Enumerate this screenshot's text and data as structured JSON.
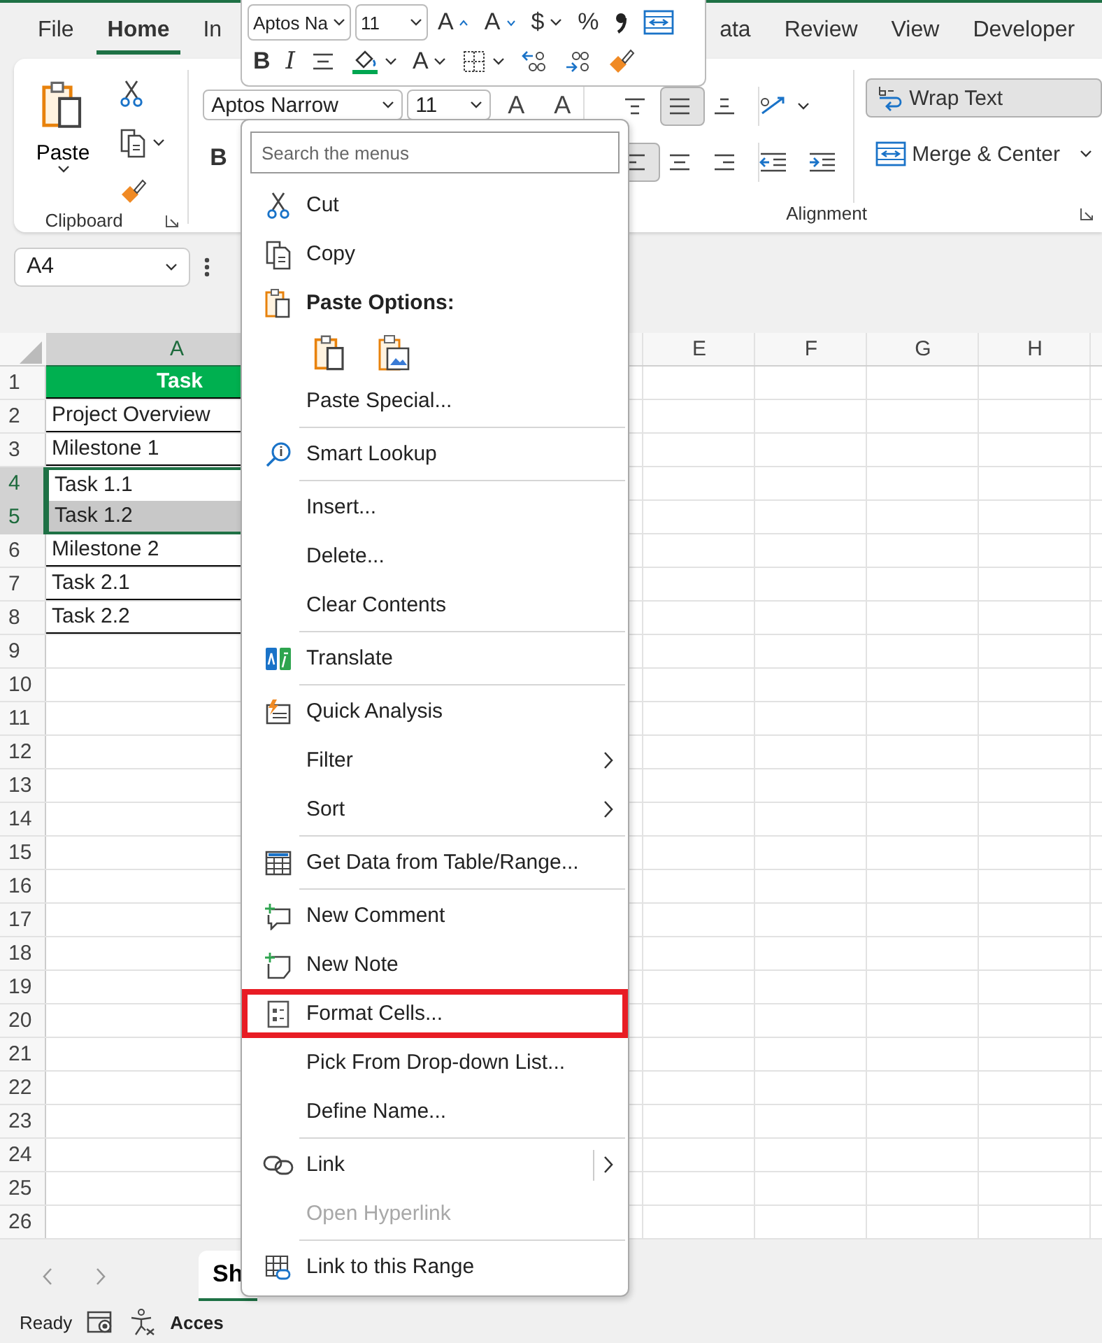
{
  "tabs": [
    {
      "label": "File",
      "selected": false
    },
    {
      "label": "Home",
      "selected": true
    },
    {
      "label": "In",
      "selected": false
    },
    {
      "label": "ata",
      "selected": false
    },
    {
      "label": "Review",
      "selected": false
    },
    {
      "label": "View",
      "selected": false
    },
    {
      "label": "Developer",
      "selected": false
    }
  ],
  "ribbon": {
    "clipboard": {
      "paste_label": "Paste",
      "group_label": "Clipboard"
    },
    "font": {
      "font_name": "Aptos Narrow",
      "font_size": "11",
      "grow": "A",
      "shrink": "A",
      "bold": "B"
    },
    "alignment": {
      "vertical": [
        {
          "selected": false
        },
        {
          "selected": true
        },
        {
          "selected": false
        }
      ],
      "horizontal": [
        {
          "selected": true
        },
        {
          "selected": false
        },
        {
          "selected": false
        }
      ],
      "wrap_text": {
        "label": "Wrap Text",
        "selected": true
      },
      "merge": {
        "label": "Merge & Center"
      },
      "group_label": "Alignment"
    }
  },
  "name_box": "A4",
  "sheet": {
    "columns": [
      {
        "label": "A",
        "selected": true
      },
      {
        "label": "E",
        "selected": false
      },
      {
        "label": "F",
        "selected": false
      },
      {
        "label": "G",
        "selected": false
      },
      {
        "label": "H",
        "selected": false
      }
    ],
    "rows": [
      {
        "number": "1",
        "selected": false,
        "cell": {
          "text": "Task",
          "kind": "header",
          "selected": false
        }
      },
      {
        "number": "2",
        "selected": false,
        "cell": {
          "text": "Project Overview",
          "kind": "data",
          "selected": false
        }
      },
      {
        "number": "3",
        "selected": false,
        "cell": {
          "text": "Milestone 1",
          "kind": "data",
          "selected": false
        }
      },
      {
        "number": "4",
        "selected": true,
        "cell": {
          "text": "Task 1.1",
          "kind": "data",
          "selected": true,
          "active": true
        }
      },
      {
        "number": "5",
        "selected": true,
        "cell": {
          "text": "Task 1.2",
          "kind": "data",
          "selected": true,
          "active": false
        }
      },
      {
        "number": "6",
        "selected": false,
        "cell": {
          "text": "Milestone 2",
          "kind": "data",
          "selected": false
        }
      },
      {
        "number": "7",
        "selected": false,
        "cell": {
          "text": "Task 2.1",
          "kind": "data",
          "selected": false
        }
      },
      {
        "number": "8",
        "selected": false,
        "cell": {
          "text": "Task 2.2",
          "kind": "data",
          "selected": false
        }
      },
      {
        "number": "9",
        "selected": false
      },
      {
        "number": "10",
        "selected": false
      },
      {
        "number": "11",
        "selected": false
      },
      {
        "number": "12",
        "selected": false
      },
      {
        "number": "13",
        "selected": false
      },
      {
        "number": "14",
        "selected": false
      },
      {
        "number": "15",
        "selected": false
      },
      {
        "number": "16",
        "selected": false
      },
      {
        "number": "17",
        "selected": false
      },
      {
        "number": "18",
        "selected": false
      },
      {
        "number": "19",
        "selected": false
      },
      {
        "number": "20",
        "selected": false
      },
      {
        "number": "21",
        "selected": false
      },
      {
        "number": "22",
        "selected": false
      },
      {
        "number": "23",
        "selected": false
      },
      {
        "number": "24",
        "selected": false
      },
      {
        "number": "25",
        "selected": false
      },
      {
        "number": "26",
        "selected": false
      }
    ]
  },
  "sheet_tabs": [
    {
      "label": "Sh",
      "selected": true
    }
  ],
  "status_bar": {
    "ready": "Ready",
    "accessibility": "Acces"
  },
  "mini_toolbar": {
    "font_name": "Aptos Na",
    "font_size": "11",
    "grow": "A",
    "shrink": "A",
    "currency": "$",
    "percent": "%",
    "bold": "B",
    "italic": "I",
    "font_color": "A"
  },
  "context_menu": {
    "search": {
      "placeholder": "Search the menus"
    },
    "items": [
      {
        "kind": "item",
        "label": "Cut"
      },
      {
        "kind": "item",
        "label": "Copy"
      },
      {
        "kind": "header",
        "label": "Paste Options:"
      },
      {
        "kind": "paste-options"
      },
      {
        "kind": "item",
        "label": "Paste Special..."
      },
      {
        "kind": "separator"
      },
      {
        "kind": "item",
        "label": "Smart Lookup"
      },
      {
        "kind": "separator"
      },
      {
        "kind": "item",
        "label": "Insert..."
      },
      {
        "kind": "item",
        "label": "Delete..."
      },
      {
        "kind": "item",
        "label": "Clear Contents"
      },
      {
        "kind": "separator"
      },
      {
        "kind": "item",
        "label": "Translate"
      },
      {
        "kind": "separator"
      },
      {
        "kind": "item",
        "label": "Quick Analysis"
      },
      {
        "kind": "item",
        "label": "Filter",
        "submenu": true
      },
      {
        "kind": "item",
        "label": "Sort",
        "submenu": true
      },
      {
        "kind": "separator"
      },
      {
        "kind": "item",
        "label": "Get Data from Table/Range..."
      },
      {
        "kind": "separator"
      },
      {
        "kind": "item",
        "label": "New Comment"
      },
      {
        "kind": "item",
        "label": "New Note"
      },
      {
        "kind": "item",
        "label": "Format Cells...",
        "highlighted": true
      },
      {
        "kind": "item",
        "label": "Pick From Drop-down List..."
      },
      {
        "kind": "item",
        "label": "Define Name..."
      },
      {
        "kind": "separator"
      },
      {
        "kind": "item",
        "label": "Link",
        "submenu": true,
        "split": true
      },
      {
        "kind": "item",
        "label": "Open Hyperlink",
        "disabled": true
      },
      {
        "kind": "separator"
      },
      {
        "kind": "item",
        "label": "Link to this Range"
      }
    ]
  }
}
